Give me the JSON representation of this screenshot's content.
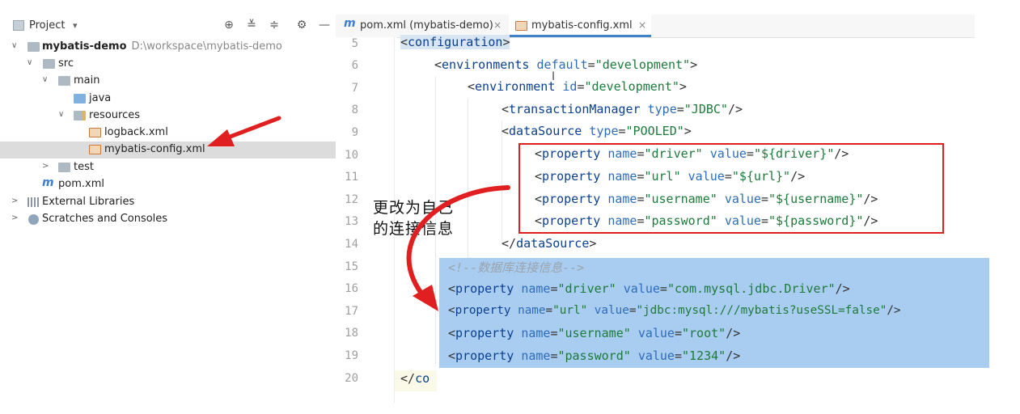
{
  "project_panel": {
    "title": "Project",
    "caret": "▾",
    "tools": [
      {
        "name": "locate-icon",
        "glyph": "⊕"
      },
      {
        "name": "expand-all-icon",
        "glyph": "≚"
      },
      {
        "name": "collapse-all-icon",
        "glyph": "≑"
      },
      {
        "name": "gear-icon",
        "glyph": "⚙"
      },
      {
        "name": "minimize-icon",
        "glyph": "—"
      }
    ],
    "tree": {
      "root": {
        "label": "mybatis-demo",
        "path": "D:\\workspace\\mybatis-demo"
      },
      "src": "src",
      "main": "main",
      "java": "java",
      "resources": "resources",
      "logback": "logback.xml",
      "mybatis_config": "mybatis-config.xml",
      "test": "test",
      "pom": "pom.xml",
      "ext_libs": "External Libraries",
      "scratches": "Scratches and Consoles"
    }
  },
  "editor": {
    "tabs": [
      {
        "label": "pom.xml (mybatis-demo)",
        "close": "×",
        "active": false
      },
      {
        "label": "mybatis-config.xml",
        "close": "×",
        "active": true
      }
    ],
    "line_numbers": [
      "5",
      "6",
      "7",
      "8",
      "9",
      "10",
      "11",
      "12",
      "13",
      "14",
      "15",
      "16",
      "17",
      "18",
      "19",
      "20"
    ],
    "lines": {
      "l5": {
        "open": "<",
        "tag": "configuration",
        "close": ">"
      },
      "l6": {
        "open": "<",
        "tag": "environments",
        "attr": "default",
        "eq": "=",
        "val": "\"development\"",
        "close": ">"
      },
      "l7": {
        "open": "<",
        "tag": "environment",
        "attr": "id",
        "eq": "=",
        "val": "\"development\"",
        "close": ">"
      },
      "l8": {
        "open": "<",
        "tag": "transactionManager",
        "attr": "type",
        "eq": "=",
        "val": "\"JDBC\"",
        "close": "/>"
      },
      "l9": {
        "open": "<",
        "tag": "dataSource",
        "attr": "type",
        "eq": "=",
        "val": "\"POOLED\"",
        "close": ">"
      },
      "l10": {
        "open": "<",
        "tag": "property",
        "a1": "name",
        "v1": "\"driver\"",
        "a2": "value",
        "v2": "\"${driver}\"",
        "close": "/>"
      },
      "l11": {
        "open": "<",
        "tag": "property",
        "a1": "name",
        "v1": "\"url\"",
        "a2": "value",
        "v2": "\"${url}\"",
        "close": "/>"
      },
      "l12": {
        "open": "<",
        "tag": "property",
        "a1": "name",
        "v1": "\"username\"",
        "a2": "value",
        "v2": "\"${username}\"",
        "close": "/>"
      },
      "l13": {
        "open": "<",
        "tag": "property",
        "a1": "name",
        "v1": "\"password\"",
        "a2": "value",
        "v2": "\"${password}\"",
        "close": "/>"
      },
      "l14": {
        "open": "</",
        "tag": "dataSource",
        "close": ">"
      },
      "l15": {
        "comment": "<!--数据库连接信息-->"
      },
      "l16": {
        "open": "<",
        "tag": "property",
        "a1": "name",
        "v1": "\"driver\"",
        "a2": "value",
        "v2": "\"com.mysql.jdbc.Driver\"",
        "close": "/>"
      },
      "l17": {
        "open": "<",
        "tag": "property",
        "a1": "name",
        "v1": "\"url\"",
        "a2": "value",
        "v2": "\"jdbc:mysql:///mybatis?useSSL=false\"",
        "close": "/>"
      },
      "l18": {
        "open": "<",
        "tag": "property",
        "a1": "name",
        "v1": "\"username\"",
        "a2": "value",
        "v2": "\"root\"",
        "close": "/>"
      },
      "l19": {
        "open": "<",
        "tag": "property",
        "a1": "name",
        "v1": "\"password\"",
        "a2": "value",
        "v2": "\"1234\"",
        "close": "/>"
      },
      "l20": {
        "open": "</",
        "tag": "co"
      }
    }
  },
  "annotation": {
    "note_line1": "更改为自己",
    "note_line2": "的连接信息",
    "red_box_color": "#e02020",
    "highlight_color": "#a9cdf1",
    "arrow_color": "#e02020"
  }
}
